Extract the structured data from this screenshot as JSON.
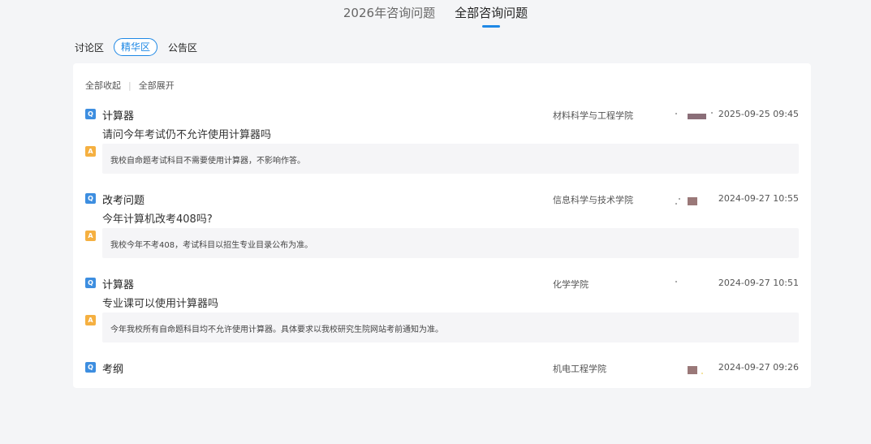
{
  "top_tabs": [
    {
      "label": "2026年咨询问题",
      "active": false
    },
    {
      "label": "全部咨询问题",
      "active": true
    }
  ],
  "sub_tabs": [
    {
      "label": "讨论区",
      "active": false
    },
    {
      "label": "精华区",
      "active": true
    },
    {
      "label": "公告区",
      "active": false
    }
  ],
  "toolbar": {
    "collapse_all": "全部收起",
    "separator": "|",
    "expand_all": "全部展开"
  },
  "items": [
    {
      "title": "计算器",
      "college": "材料科学与工程学院",
      "date": "2025-09-25 09:45",
      "question": "请问今年考试仍不允许使用计算器吗",
      "answer": "我校自命题考试科目不需要使用计算器，不影响作答。"
    },
    {
      "title": "改考问题",
      "college": "信息科学与技术学院",
      "date": "2024-09-27 10:55",
      "question": "今年计算机改考408吗?",
      "answer": "我校今年不考408，考试科目以招生专业目录公布为准。"
    },
    {
      "title": "计算器",
      "college": "化学学院",
      "date": "2024-09-27 10:51",
      "question": "专业课可以使用计算器吗",
      "answer": "今年我校所有自命题科目均不允许使用计算器。具体要求以我校研究生院网站考前通知为准。"
    },
    {
      "title": "考纲",
      "college": "机电工程学院",
      "date": "2024-09-27 09:26",
      "question": "",
      "answer": ""
    }
  ],
  "badges": {
    "question": "Q",
    "answer": "A"
  },
  "colors": {
    "accent": "#1e88e5",
    "q_badge": "#3d8ee0",
    "a_badge": "#f5b041",
    "background": "#f4f5f7"
  }
}
